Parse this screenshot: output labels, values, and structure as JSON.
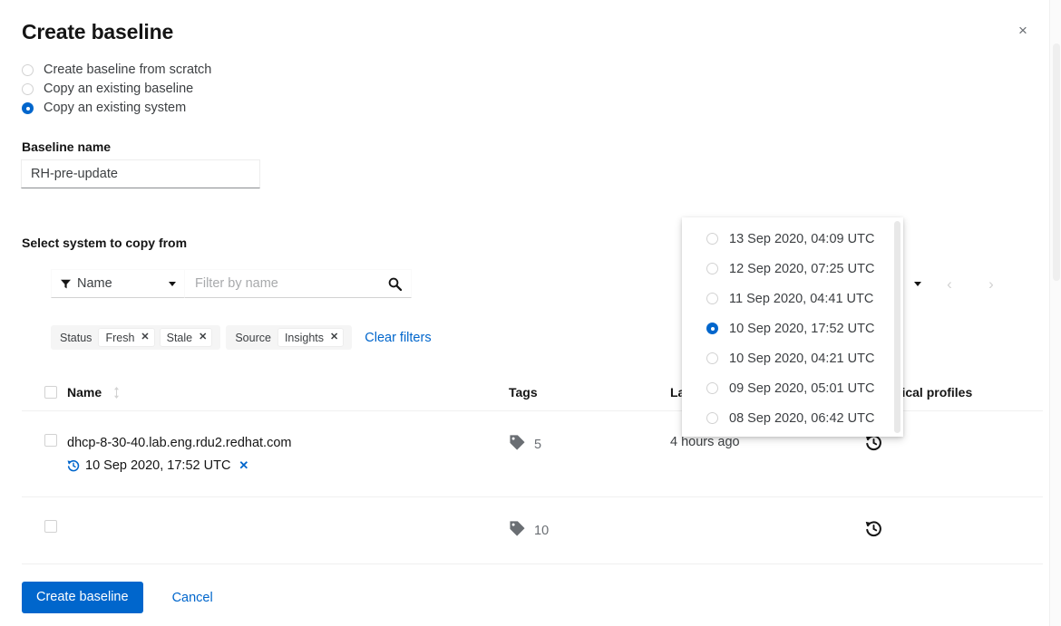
{
  "modal": {
    "title": "Create baseline",
    "close_label": "×"
  },
  "creation_mode": {
    "options": [
      {
        "label": "Create baseline from scratch",
        "selected": false
      },
      {
        "label": "Copy an existing baseline",
        "selected": false
      },
      {
        "label": "Copy an existing system",
        "selected": true
      }
    ]
  },
  "baseline_name": {
    "label": "Baseline name",
    "value": "RH-pre-update",
    "placeholder": ""
  },
  "select_system": {
    "label": "Select system to copy from",
    "toolbar": {
      "filter_select_value": "Name",
      "search_placeholder": "Filter by name",
      "search_value": ""
    },
    "chips": {
      "groups": [
        {
          "label": "Status",
          "items": [
            "Fresh",
            "Stale"
          ]
        },
        {
          "label": "Source",
          "items": [
            "Insights"
          ]
        }
      ],
      "clear_label": "Clear filters"
    },
    "pagination": {
      "prev_label": "‹",
      "next_label": "›"
    },
    "table": {
      "columns": [
        "Name",
        "Tags",
        "Last seen",
        "Historical profiles"
      ],
      "visible_column_fragment": "cal profiles",
      "rows": [
        {
          "hostname": "dhcp-8-30-40.lab.eng.rdu2.redhat.com",
          "selected_profile": "10 Sep 2020, 17:52 UTC",
          "tags": "5",
          "last_seen": "4 hours ago"
        },
        {
          "hostname": "",
          "selected_profile": "",
          "tags": "10",
          "last_seen": ""
        }
      ]
    }
  },
  "profile_dropdown": {
    "options": [
      {
        "label": "13 Sep 2020, 04:09 UTC",
        "selected": false
      },
      {
        "label": "12 Sep 2020, 07:25 UTC",
        "selected": false
      },
      {
        "label": "11 Sep 2020, 04:41 UTC",
        "selected": false
      },
      {
        "label": "10 Sep 2020, 17:52 UTC",
        "selected": true
      },
      {
        "label": "10 Sep 2020, 04:21 UTC",
        "selected": false
      },
      {
        "label": "09 Sep 2020, 05:01 UTC",
        "selected": false
      },
      {
        "label": "08 Sep 2020, 06:42 UTC",
        "selected": false
      }
    ]
  },
  "footer": {
    "primary_label": "Create baseline",
    "cancel_label": "Cancel"
  },
  "colors": {
    "accent": "#0066cc",
    "text": "#151515",
    "muted": "#6a6e73",
    "border": "#d2d2d2"
  }
}
